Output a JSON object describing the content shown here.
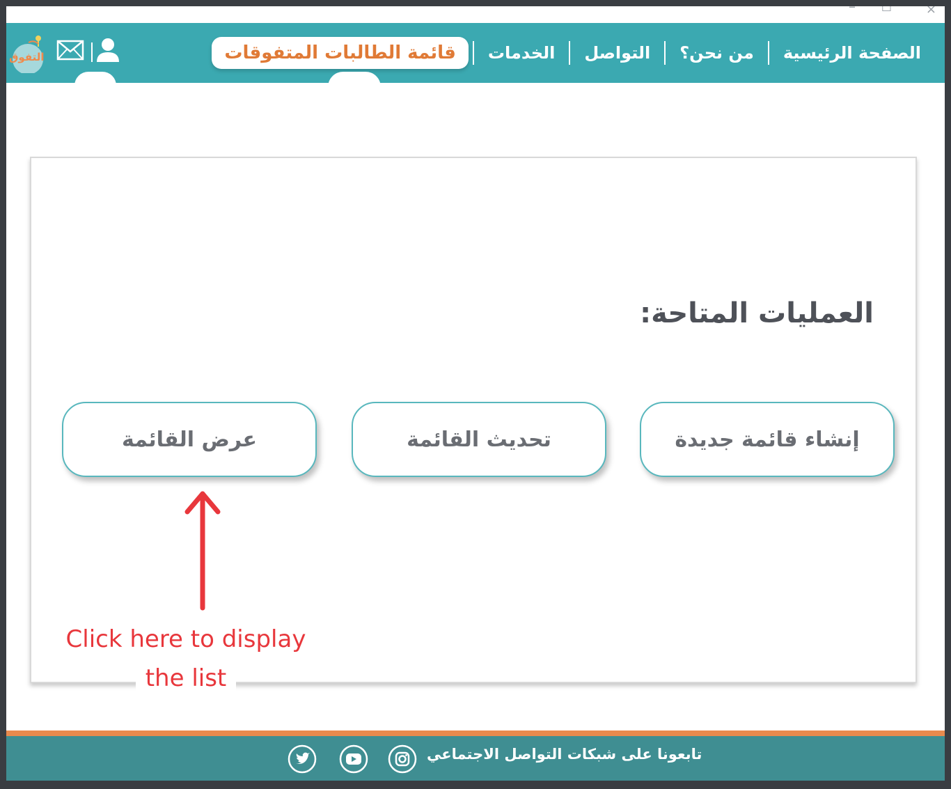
{
  "window": {
    "controls": {
      "minimize": "–",
      "maximize": "□",
      "close": "×"
    }
  },
  "header": {
    "nav": [
      {
        "label": "الصفحة الرئيسية",
        "active": false
      },
      {
        "label": "من نحن؟",
        "active": false
      },
      {
        "label": "التواصل",
        "active": false
      },
      {
        "label": "الخدمات",
        "active": false
      },
      {
        "label": "قائمة الطالبات المتفوقات",
        "active": true
      }
    ],
    "logo_text": "التفوق",
    "icons": [
      "user-icon",
      "mail-icon",
      "logo-icon"
    ]
  },
  "main": {
    "ops_title": "العمليات المتاحة:",
    "buttons": [
      {
        "label": "إنشاء قائمة جديدة"
      },
      {
        "label": "تحديث القائمة"
      },
      {
        "label": "عرض القائمة"
      }
    ],
    "annotation": {
      "line1": "Click here to display",
      "line2": "the list"
    }
  },
  "footer": {
    "social_text": "تابعونا على شبكات التواصل الاجتماعي",
    "icons": [
      "instagram-icon",
      "youtube-icon",
      "twitter-icon"
    ]
  },
  "colors": {
    "header_bg": "#3ba9b1",
    "active_tab_text": "#e07a36",
    "button_border": "#58b7bd",
    "footer_bg": "#3f8e92",
    "footer_stripe": "#e88a4e",
    "annotation": "#e8373c"
  }
}
